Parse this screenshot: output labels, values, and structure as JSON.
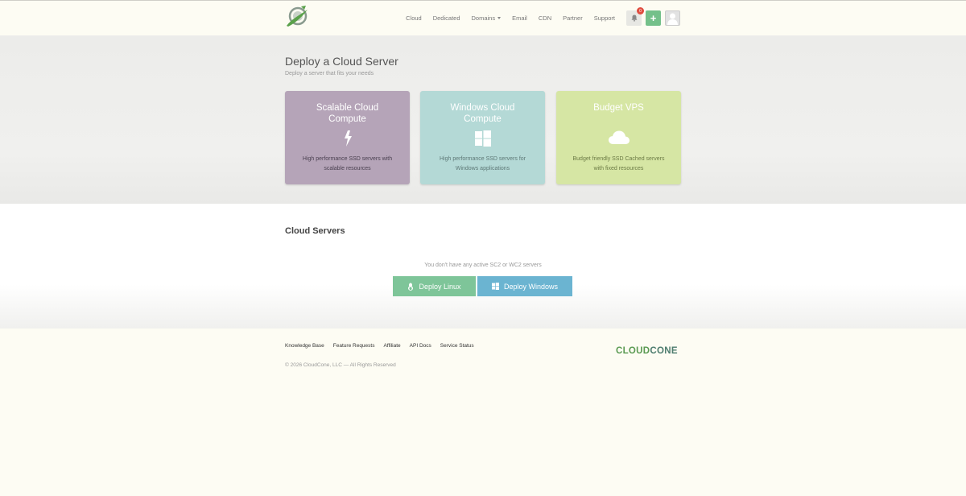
{
  "nav": {
    "items": [
      "Cloud",
      "Dedicated",
      "Domains",
      "Email",
      "CDN",
      "Partner",
      "Support"
    ],
    "notification_count": "0",
    "plus_label": "+"
  },
  "hero": {
    "title": "Deploy a Cloud Server",
    "subtitle": "Deploy a server that fits your needs",
    "cards": [
      {
        "title": "Scalable Cloud Compute",
        "desc": "High performance SSD servers with scalable resources",
        "icon": "lightning-icon",
        "color": "#b5a4b8"
      },
      {
        "title": "Windows Cloud Compute",
        "desc": "High performance SSD servers for Windows applications",
        "icon": "windows-icon",
        "color": "#b4d9d6"
      },
      {
        "title": "Budget VPS",
        "desc": "Budget friendly SSD Cached servers with fixed resources",
        "icon": "cloud-icon",
        "color": "#d6e6a4"
      }
    ]
  },
  "servers": {
    "title": "Cloud Servers",
    "empty_message": "You don't have any active SC2 or WC2 servers",
    "deploy_linux": "Deploy Linux",
    "deploy_windows": "Deploy Windows"
  },
  "footer": {
    "links": [
      "Knowledge Base",
      "Feature Requests",
      "Affiliate",
      "API Docs",
      "Service Status"
    ],
    "copyright": "© 2026 CloudCone, LLC — All Rights Reserved",
    "brand_part1": "CLOUD",
    "brand_part2": "CONE"
  },
  "colors": {
    "accent_green": "#74c08a",
    "linux_button": "#7ec599",
    "windows_button": "#6bb4d1",
    "badge_red": "#e04c3f"
  }
}
